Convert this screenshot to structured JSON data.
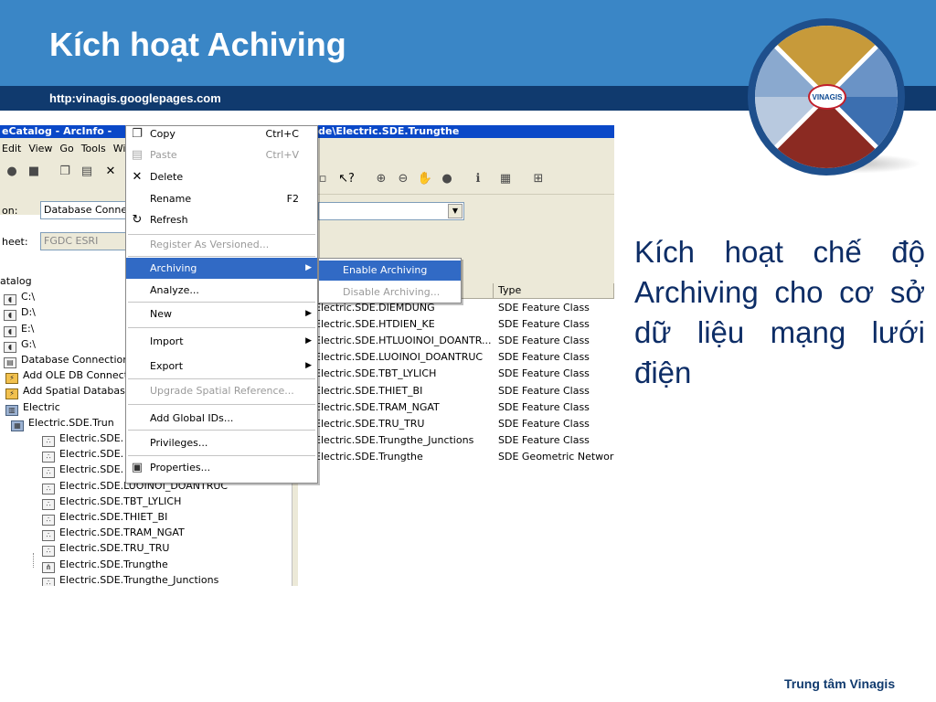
{
  "slide": {
    "title": "Kích hoạt Achiving",
    "url": "http:vinagis.googlepages.com",
    "logo_text": "VINAGIS",
    "body_text": "Kích hoạt chế độ Archiving cho cơ sở dữ liệu mạng lưới điện",
    "footer": "Trung tâm Vinagis"
  },
  "colors": {
    "header_blue": "#3a86c6",
    "header_navy": "#103a6e",
    "menu_selected": "#316ac5",
    "titlebar": "#0a48c8"
  },
  "app": {
    "title_left": "eCatalog - ArcInfo - ",
    "title_right": "de\\Electric.SDE.Trungthe",
    "menubar": [
      "Edit",
      "View",
      "Go",
      "Tools",
      "Wi"
    ],
    "location_label": "on:",
    "location_value": "Database Conne",
    "sheet_label": "heet:",
    "sheet_value": "FGDC ESRI"
  },
  "tree": {
    "items": [
      {
        "label": "atalog",
        "icon": "catalog-icon"
      },
      {
        "label": "C:\\",
        "icon": "drive-icon"
      },
      {
        "label": "D:\\",
        "icon": "drive-icon"
      },
      {
        "label": "E:\\",
        "icon": "drive-icon"
      },
      {
        "label": "G:\\",
        "icon": "drive-icon"
      },
      {
        "label": "Database Connections",
        "icon": "database-icon"
      },
      {
        "label": "Add OLE DB Connect",
        "icon": "connection-icon"
      },
      {
        "label": "Add Spatial Database",
        "icon": "connection-icon"
      },
      {
        "label": "Electric",
        "icon": "server-icon"
      },
      {
        "label": "Electric.SDE.Trun",
        "icon": "feature-dataset-icon"
      },
      {
        "label": "Electric.SDE.",
        "icon": "feature-class-icon"
      },
      {
        "label": "Electric.SDE.",
        "icon": "feature-class-icon"
      },
      {
        "label": "Electric.SDE.",
        "icon": "feature-class-icon"
      },
      {
        "label": "Electric.SDE.LUOINOI_DOANTRUC",
        "icon": "feature-class-icon"
      },
      {
        "label": "Electric.SDE.TBT_LYLICH",
        "icon": "feature-class-icon"
      },
      {
        "label": "Electric.SDE.THIET_BI",
        "icon": "feature-class-icon"
      },
      {
        "label": "Electric.SDE.TRAM_NGAT",
        "icon": "feature-class-icon"
      },
      {
        "label": "Electric.SDE.TRU_TRU",
        "icon": "feature-class-icon"
      },
      {
        "label": "Electric.SDE.Trungthe",
        "icon": "network-icon"
      },
      {
        "label": "Electric.SDE.Trungthe_Junctions",
        "icon": "feature-class-icon"
      }
    ]
  },
  "list": {
    "headers": [
      "",
      "Type"
    ],
    "rows": [
      {
        "name": "Electric.SDE.DIEMDUNG",
        "type": "SDE Feature Class"
      },
      {
        "name": "Electric.SDE.HTDIEN_KE",
        "type": "SDE Feature Class"
      },
      {
        "name": "Electric.SDE.HTLUOINOI_DOANTR...",
        "type": "SDE Feature Class"
      },
      {
        "name": "Electric.SDE.LUOINOI_DOANTRUC",
        "type": "SDE Feature Class"
      },
      {
        "name": "Electric.SDE.TBT_LYLICH",
        "type": "SDE Feature Class"
      },
      {
        "name": "Electric.SDE.THIET_BI",
        "type": "SDE Feature Class"
      },
      {
        "name": "Electric.SDE.TRAM_NGAT",
        "type": "SDE Feature Class"
      },
      {
        "name": "Electric.SDE.TRU_TRU",
        "type": "SDE Feature Class"
      },
      {
        "name": "Electric.SDE.Trungthe_Junctions",
        "type": "SDE Feature Class"
      },
      {
        "name": "Electric.SDE.Trungthe",
        "type": "SDE Geometric Network"
      }
    ]
  },
  "context_menu": {
    "copy": "Copy",
    "copy_sc": "Ctrl+C",
    "paste": "Paste",
    "paste_sc": "Ctrl+V",
    "delete": "Delete",
    "rename": "Rename",
    "rename_sc": "F2",
    "refresh": "Refresh",
    "register": "Register As Versioned...",
    "archiving": "Archiving",
    "analyze": "Analyze...",
    "new": "New",
    "import": "Import",
    "export": "Export",
    "upgrade": "Upgrade Spatial Reference...",
    "add_global_ids": "Add Global IDs...",
    "privileges": "Privileges...",
    "properties": "Properties..."
  },
  "submenu": {
    "enable": "Enable Archiving",
    "disable": "Disable Archiving..."
  }
}
